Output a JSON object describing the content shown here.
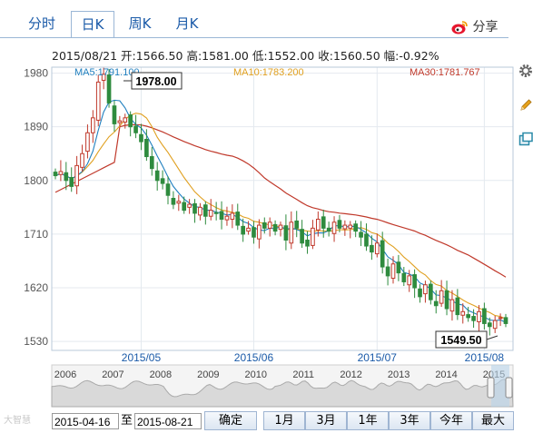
{
  "tabs": [
    {
      "label": "分时",
      "active": false
    },
    {
      "label": "日K",
      "active": true
    },
    {
      "label": "周K",
      "active": false
    },
    {
      "label": "月K",
      "active": false
    }
  ],
  "share_label": "分享",
  "info": {
    "date": "2015/08/21",
    "open_label": "开:",
    "open": "1566.50",
    "high_label": "高:",
    "high": "1581.00",
    "low_label": "低:",
    "low": "1552.00",
    "close_label": "收:",
    "close": "1560.50",
    "change_label": "幅:",
    "change": "-0.92%"
  },
  "ma": {
    "ma5": "MA5:1791.100",
    "ma10": "MA10:1783.200",
    "ma30": "MA30:1781.767",
    "colors": {
      "ma5": "#1f7fbf",
      "ma10": "#e0a020",
      "ma30": "#c0392b"
    }
  },
  "annotations": {
    "max": "1978.00",
    "min": "1549.50"
  },
  "chart_data": {
    "type": "candlestick",
    "y_ticks": [
      "1980",
      "1890",
      "1800",
      "1710",
      "1620",
      "1530"
    ],
    "ylim": [
      1515,
      1990
    ],
    "x_ticks": [
      "2015/05",
      "2015/06",
      "2015/07",
      "2015/08"
    ],
    "period": [
      "2015-04-16",
      "2015-08-21"
    ],
    "path": [
      1808,
      1815,
      1800,
      1790,
      1825,
      1845,
      1880,
      1905,
      1965,
      1978,
      1930,
      1895,
      1900,
      1905,
      1890,
      1880,
      1865,
      1840,
      1820,
      1800,
      1795,
      1775,
      1760,
      1765,
      1750,
      1760,
      1745,
      1755,
      1740,
      1750,
      1745,
      1735,
      1740,
      1745,
      1725,
      1710,
      1720,
      1705,
      1725,
      1720,
      1730,
      1715,
      1725,
      1700,
      1730,
      1720,
      1695,
      1690,
      1720,
      1735,
      1720,
      1715,
      1730,
      1720,
      1725,
      1725,
      1715,
      1705,
      1690,
      1680,
      1695,
      1655,
      1640,
      1660,
      1645,
      1630,
      1640,
      1620,
      1605,
      1625,
      1600,
      1590,
      1615,
      1585,
      1600,
      1575,
      1580,
      1570,
      1565,
      1580,
      1560,
      1555,
      1565,
      1570,
      1560
    ],
    "ma5": 1791.1,
    "ma10": 1783.2,
    "ma30": 1781.767,
    "ma_colors": {
      "ma5": "#1f7fbf",
      "ma10": "#e0a020",
      "ma30": "#c0392b"
    },
    "up_color": "#c0392b",
    "down_color": "#2e8b3e",
    "grid": true
  },
  "navigator": {
    "years": [
      "2006",
      "2007",
      "2008",
      "2009",
      "2010",
      "2011",
      "2012",
      "2013",
      "2014",
      "2015"
    ]
  },
  "range": {
    "from": "2015-04-16",
    "to_label": "至",
    "to": "2015-08-21",
    "confirm": "确定",
    "buttons": [
      "1月",
      "3月",
      "1年",
      "3年",
      "今年",
      "最大"
    ]
  },
  "watermark": "大智慧"
}
